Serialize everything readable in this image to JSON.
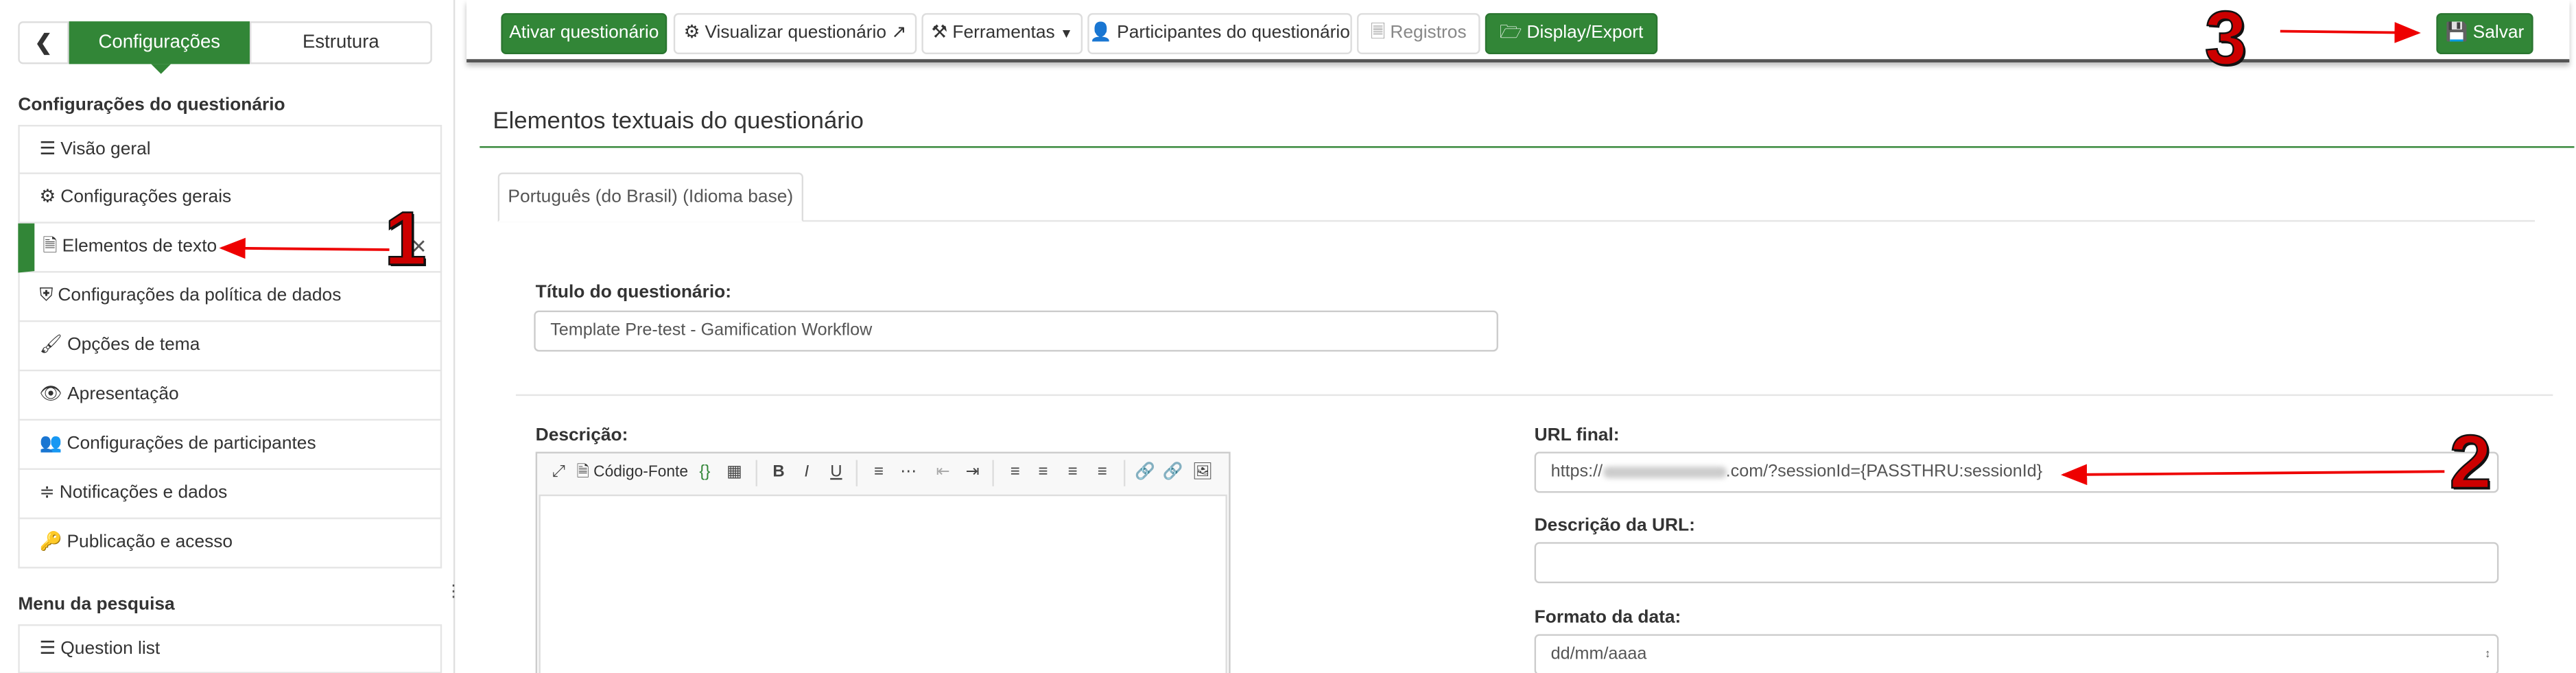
{
  "sidebar": {
    "back_icon": "chevron-left-icon",
    "tabs": [
      "Configurações",
      "Estrutura"
    ],
    "section_title": "Configurações do questionário",
    "items": [
      {
        "label": "Visão geral",
        "icon": "list-icon"
      },
      {
        "label": "Configurações gerais",
        "icon": "gears-icon"
      },
      {
        "label": "Elementos de texto",
        "icon": "file-text-icon"
      },
      {
        "label": "Configurações da política de dados",
        "icon": "shield-icon"
      },
      {
        "label": "Opções de tema",
        "icon": "brush-icon"
      },
      {
        "label": "Apresentação",
        "icon": "eye-icon"
      },
      {
        "label": "Configurações de participantes",
        "icon": "users-icon"
      },
      {
        "label": "Notificações e dados",
        "icon": "feed-icon"
      },
      {
        "label": "Publicação e acesso",
        "icon": "key-icon"
      }
    ],
    "menu_title": "Menu da pesquisa",
    "menu_items": [
      {
        "label": "Question list",
        "icon": "list-icon"
      }
    ],
    "active_index": 2
  },
  "toolbar": {
    "activate": "Ativar questionário",
    "preview": "Visualizar questionário",
    "tools": "Ferramentas",
    "participants": "Participantes do questionário",
    "logs": "Registros",
    "display_export": "Display/Export",
    "save": "Salvar"
  },
  "main": {
    "heading": "Elementos textuais do questionário",
    "lang_tab": "Português (do Brasil) (Idioma base)",
    "title_label": "Título do questionário:",
    "title_value": "Template Pre-test - Gamification Workflow",
    "description_label": "Descrição:",
    "editor_source": "Código-Fonte",
    "url_label": "URL final:",
    "url_value_prefix": "https://",
    "url_value_suffix": ".com/?sessionId={PASSTHRU:sessionId}",
    "url_desc_label": "Descrição da URL:",
    "url_desc_value": "",
    "date_label": "Formato da data:",
    "date_value": "dd/mm/aaaa"
  },
  "annotations": [
    "1",
    "2",
    "3"
  ],
  "colors": {
    "accent": "#328637",
    "annotation": "#cc0000"
  }
}
